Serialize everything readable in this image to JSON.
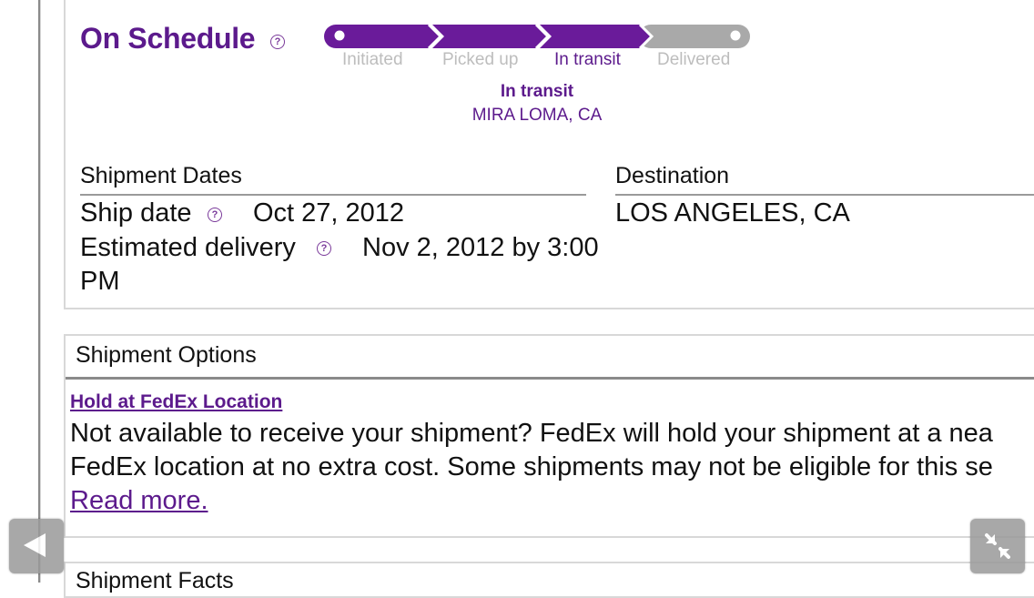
{
  "status": {
    "heading": "On Schedule",
    "current_status": "In transit",
    "current_location": "MIRA LOMA, CA",
    "stages": [
      {
        "label": "Initiated",
        "active": false
      },
      {
        "label": "Picked up",
        "active": false
      },
      {
        "label": "In transit",
        "active": true
      },
      {
        "label": "Delivered",
        "active": false
      }
    ],
    "progress_completed_stages": 3,
    "progress_total_stages": 4
  },
  "shipment_dates": {
    "title": "Shipment Dates",
    "ship_date_label": "Ship date",
    "ship_date_value": "Oct 27, 2012",
    "estimated_delivery_label": "Estimated delivery",
    "estimated_delivery_value_line1": "Nov 2, 2012 by 3:00",
    "estimated_delivery_value_line2": "PM"
  },
  "destination": {
    "title": "Destination",
    "value": "LOS ANGELES, CA"
  },
  "shipment_options": {
    "title": "Shipment Options",
    "hold_link": "Hold at FedEx Location",
    "description_line1": "Not available to receive your shipment? FedEx will hold your shipment at a nea",
    "description_line2": "FedEx location at no extra cost. Some shipments may not be eligible for this se",
    "read_more": "Read more."
  },
  "shipment_facts": {
    "title": "Shipment Facts"
  },
  "help_glyph": "?",
  "colors": {
    "brand_purple": "#5c1a8c",
    "inactive_stage": "#bdbdbd",
    "progress_inactive": "#a9a9a9"
  },
  "icons": {
    "back": "back-arrow-icon",
    "shrink": "shrink-arrows-icon",
    "help": "help-icon"
  }
}
